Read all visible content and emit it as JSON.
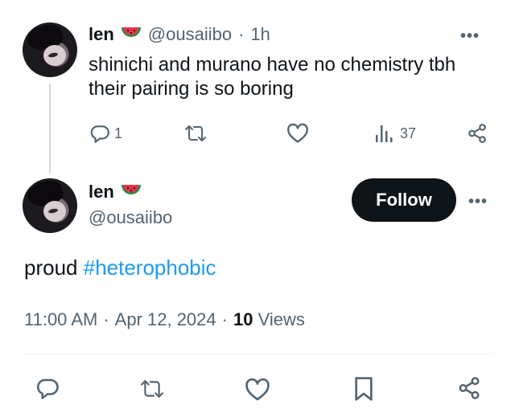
{
  "reply_tweet": {
    "display_name": "len",
    "handle": "@ousaiibo",
    "separator": "·",
    "time_ago": "1h",
    "text": "shinichi and murano have no chemistry tbh\ntheir pairing is so boring",
    "reply_count": "1",
    "view_count": "37",
    "more_label": "•••"
  },
  "main_tweet": {
    "display_name": "len",
    "handle": "@ousaiibo",
    "follow_label": "Follow",
    "more_label": "•••",
    "text_prefix": "proud ",
    "hashtag": "#heterophobic",
    "time": "11:00 AM",
    "dot1": "·",
    "date": "Apr 12, 2024",
    "dot2": "·",
    "views_count": "10",
    "views_label": "Views"
  },
  "icons": [
    "watermelon-icon",
    "reply-icon",
    "retweet-icon",
    "like-icon",
    "views-icon",
    "share-icon",
    "bookmark-icon",
    "more-icon"
  ],
  "colors": {
    "text": "#0f1419",
    "secondary": "#536471",
    "link": "#1d9bf0",
    "follow_bg": "#0f1419",
    "divider": "#eff3f4"
  }
}
